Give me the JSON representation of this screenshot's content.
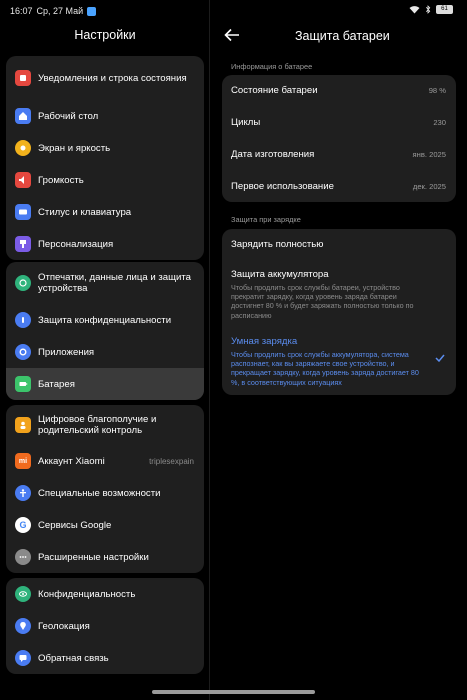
{
  "status_bar": {
    "time": "16:07",
    "date": "Ср, 27 Май",
    "battery": "61"
  },
  "settings": {
    "title": "Настройки",
    "groups": [
      [
        {
          "label": "Уведомления и строка состояния",
          "icon": "notification-icon",
          "color": "#e5483f"
        },
        {
          "label": "Рабочий стол",
          "icon": "home-icon",
          "color": "#4a7cf2"
        },
        {
          "label": "Экран и яркость",
          "icon": "sun-icon",
          "color": "#f2b21c"
        },
        {
          "label": "Громкость",
          "icon": "volume-icon",
          "color": "#e5483f"
        },
        {
          "label": "Стилус и клавиатура",
          "icon": "keyboard-icon",
          "color": "#4a7cf2"
        },
        {
          "label": "Персонализация",
          "icon": "brush-icon",
          "color": "#7b5ce6"
        }
      ],
      [
        {
          "label": "Отпечатки, данные лица и защита устройства",
          "icon": "fingerprint-icon",
          "color": "#2fb37c"
        },
        {
          "label": "Защита конфиденциальности",
          "icon": "privacy-icon",
          "color": "#4a7cf2"
        },
        {
          "label": "Приложения",
          "icon": "gear-icon",
          "color": "#4a7cf2"
        },
        {
          "label": "Батарея",
          "icon": "battery-icon",
          "color": "#3cc46b"
        }
      ],
      [
        {
          "label": "Цифровое благополучие и родительский контроль",
          "icon": "wellbeing-icon",
          "color": "#f2a21c"
        },
        {
          "label": "Аккаунт Xiaomi",
          "icon": "xiaomi-icon",
          "color": "#f06a1e",
          "aux": "triplesexpain"
        },
        {
          "label": "Специальные возможности",
          "icon": "accessibility-icon",
          "color": "#4a7cf2"
        },
        {
          "label": "Сервисы Google",
          "icon": "google-icon",
          "color": "#ffffff"
        },
        {
          "label": "Расширенные настройки",
          "icon": "more-icon",
          "color": "#8a8a8a"
        }
      ],
      [
        {
          "label": "Конфиденциальность",
          "icon": "eye-icon",
          "color": "#2fb37c"
        },
        {
          "label": "Геолокация",
          "icon": "location-icon",
          "color": "#4a7cf2"
        },
        {
          "label": "Обратная связь",
          "icon": "feedback-icon",
          "color": "#4a7cf2"
        }
      ]
    ]
  },
  "battery_protection": {
    "title": "Защита батареи",
    "info_section": "Информация о батарее",
    "info": [
      {
        "label": "Состояние батареи",
        "value": "98 %"
      },
      {
        "label": "Циклы",
        "value": "230"
      },
      {
        "label": "Дата изготовления",
        "value": "янв. 2025"
      },
      {
        "label": "Первое использование",
        "value": "дек. 2025"
      }
    ],
    "charging_section": "Защита при зарядке",
    "options": [
      {
        "title": "Зарядить полностью",
        "desc": ""
      },
      {
        "title": "Защита аккумулятора",
        "desc": "Чтобы продлить срок службы батареи, устройство прекратит зарядку, когда уровень заряда батареи достигнет 80 % и будет заряжать полностью только по расписанию"
      },
      {
        "title": "Умная зарядка",
        "desc": "Чтобы продлить срок службы аккумулятора, система распознает, как вы заряжаете свое устройство, и прекращает зарядку, когда уровень заряда достигает 80 %, в соответствующих ситуациях",
        "selected": true
      }
    ],
    "accent_color": "#5b8def"
  }
}
